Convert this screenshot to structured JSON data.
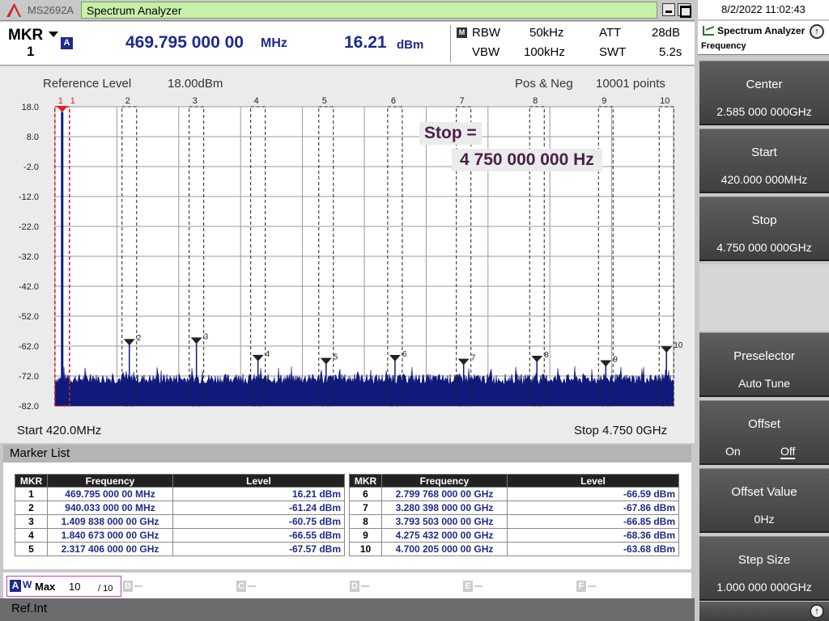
{
  "titlebar": {
    "model": "MS2692A",
    "app_title": "Spectrum Analyzer"
  },
  "datetime": "8/2/2022 11:02:43",
  "header": {
    "mkr_label": "MKR",
    "mkr_number": "1",
    "trace_letter": "A",
    "marker_freq": "469.795 000 00",
    "marker_freq_unit": "MHz",
    "marker_level": "16.21",
    "marker_level_unit": "dBm",
    "m_icon": "M",
    "rbw_label": "RBW",
    "rbw_value": "50kHz",
    "vbw_label": "VBW",
    "vbw_value": "100kHz",
    "att_label": "ATT",
    "att_value": "28dB",
    "swt_label": "SWT",
    "swt_value": "5.2s"
  },
  "graph": {
    "ref_level_label": "Reference Level",
    "ref_level_value": "18.00dBm",
    "detection": "Pos & Neg",
    "points": "10001 points",
    "start_label": "Start 420.0MHz",
    "stop_label": "Stop 4.750 0GHz",
    "popup_line1": "Stop =",
    "popup_line2": "4 750 000 000 Hz",
    "y_ticks": [
      "18.0",
      "8.0",
      "-2.0",
      "-12.0",
      "-22.0",
      "-32.0",
      "-42.0",
      "-52.0",
      "-62.0",
      "-72.0",
      "-82.0"
    ],
    "trace_color": "#0f1a7a",
    "marker1_color": "#e02020"
  },
  "chart_data": {
    "type": "line",
    "title": "",
    "xlabel": "",
    "ylabel": "",
    "x_range_mhz": [
      420,
      4750
    ],
    "ylim": [
      -82,
      18
    ],
    "noise_floor_dbm": -73,
    "markers": [
      {
        "id": "1",
        "freq_mhz": 469.795,
        "level_dbm": 16.21
      },
      {
        "id": "2",
        "freq_mhz": 940.033,
        "level_dbm": -61.24
      },
      {
        "id": "3",
        "freq_mhz": 1409.838,
        "level_dbm": -60.75
      },
      {
        "id": "4",
        "freq_mhz": 1840.673,
        "level_dbm": -66.55
      },
      {
        "id": "5",
        "freq_mhz": 2317.406,
        "level_dbm": -67.57
      },
      {
        "id": "6",
        "freq_mhz": 2799.768,
        "level_dbm": -66.59
      },
      {
        "id": "7",
        "freq_mhz": 3280.398,
        "level_dbm": -67.86
      },
      {
        "id": "8",
        "freq_mhz": 3793.503,
        "level_dbm": -66.85
      },
      {
        "id": "9",
        "freq_mhz": 4275.432,
        "level_dbm": -68.36
      },
      {
        "id": "10",
        "freq_mhz": 4700.205,
        "level_dbm": -63.68
      }
    ],
    "grid": true
  },
  "marker_list": {
    "title": "Marker List",
    "headers": [
      "MKR",
      "Frequency",
      "Level"
    ],
    "rows": [
      [
        "1",
        "469.795 000 00 MHz",
        "16.21 dBm"
      ],
      [
        "2",
        "940.033 000 00 MHz",
        "-61.24 dBm"
      ],
      [
        "3",
        "1.409 838 000 00 GHz",
        "-60.75 dBm"
      ],
      [
        "4",
        "1.840 673 000 00 GHz",
        "-66.55 dBm"
      ],
      [
        "5",
        "2.317 406 000 00 GHz",
        "-67.57 dBm"
      ],
      [
        "6",
        "2.799 768 000 00 GHz",
        "-66.59 dBm"
      ],
      [
        "7",
        "3.280 398 000 00 GHz",
        "-67.86 dBm"
      ],
      [
        "8",
        "3.793 503 000 00 GHz",
        "-66.85 dBm"
      ],
      [
        "9",
        "4.275 432 000 00 GHz",
        "-68.36 dBm"
      ],
      [
        "10",
        "4.700 205 000 00 GHz",
        "-63.68 dBm"
      ]
    ]
  },
  "trace_bar": {
    "active_letter": "A",
    "active_sub": "W",
    "mode": "Max",
    "count": "10",
    "total": "/ 10",
    "others": [
      "B",
      "C",
      "D",
      "E",
      "F"
    ]
  },
  "status": {
    "ref": "Ref.Int"
  },
  "right_panel": {
    "title": "Spectrum Analyzer",
    "subtitle": "Frequency",
    "up_icon": "↑",
    "softkeys": [
      {
        "label": "Center",
        "value": "2.585 000 000GHz"
      },
      {
        "label": "Start",
        "value": "420.000 000MHz"
      },
      {
        "label": "Stop",
        "value": "4.750 000 000GHz"
      },
      {
        "label": "Preselector",
        "value": "Auto Tune"
      },
      {
        "label": "Offset",
        "on": "On",
        "off": "Off"
      },
      {
        "label": "Offset Value",
        "value": "0Hz"
      },
      {
        "label": "Step Size",
        "value": "1.000 000 000GHz"
      }
    ],
    "bottom_icon": "↑"
  }
}
